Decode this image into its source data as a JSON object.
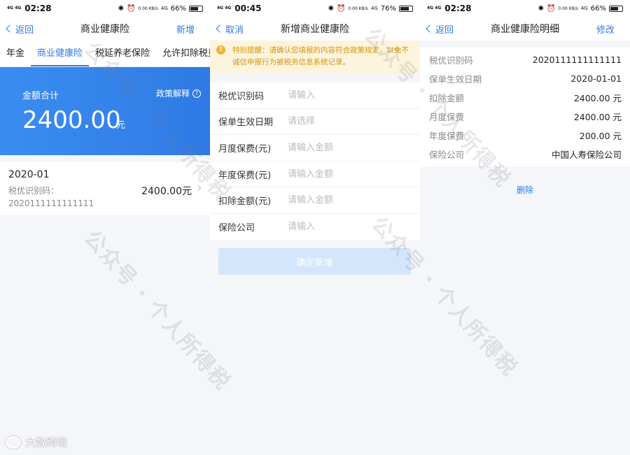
{
  "status_bars": [
    {
      "signal": "4G 4G",
      "time": "02:28",
      "speed": "0.00 KB/s",
      "net": "4G",
      "battery": "66%",
      "battery_level": 0.66
    },
    {
      "signal": "4G 4G",
      "time": "00:45",
      "speed": "0.00 KB/s",
      "net": "4G",
      "battery": "76%",
      "battery_level": 0.76
    },
    {
      "signal": "4G 4G",
      "time": "02:28",
      "speed": "0.00 KB/s",
      "net": "4G",
      "battery": "66%",
      "battery_level": 0.66
    }
  ],
  "screen1": {
    "back_label": "返回",
    "title": "商业健康险",
    "action": "新增",
    "tabs": [
      "年金",
      "商业健康险",
      "税延养老保险",
      "允许扣除税费"
    ],
    "active_tab": 1,
    "summary": {
      "label": "金额合计",
      "policy_link": "政策解释",
      "amount": "2400.00",
      "unit": "元"
    },
    "record": {
      "date": "2020-01",
      "code_label": "税优识别码：",
      "code": "2020111111111111",
      "amount": "2400.00元"
    }
  },
  "screen2": {
    "cancel_label": "取消",
    "title": "新增商业健康险",
    "notice": "特别提醒：请确认您填报的内容符合政策规定，以免不诚信申报行为被税务信息系统记录。",
    "fields": [
      {
        "label": "税优识别码",
        "placeholder": "请输入"
      },
      {
        "label": "保单生效日期",
        "placeholder": "请选择"
      },
      {
        "label": "月度保费(元)",
        "placeholder": "请输入金额"
      },
      {
        "label": "年度保费(元)",
        "placeholder": "请输入金额"
      },
      {
        "label": "扣除金额(元)",
        "placeholder": "请输入金额"
      },
      {
        "label": "保险公司",
        "placeholder": "请输入"
      }
    ],
    "submit_label": "确定新增"
  },
  "screen3": {
    "back_label": "返回",
    "title": "商业健康险明细",
    "action": "修改",
    "rows": [
      {
        "label": "税优识别码",
        "value": "2020111111111111"
      },
      {
        "label": "保单生效日期",
        "value": "2020-01-01"
      },
      {
        "label": "扣除金额",
        "value": "2400.00 元"
      },
      {
        "label": "月度保费",
        "value": "2400.00 元"
      },
      {
        "label": "年度保费",
        "value": "200.00 元"
      },
      {
        "label": "保险公司",
        "value": "中国人寿保险公司"
      }
    ],
    "delete_label": "删除"
  },
  "watermark": "公众号 · 个人所得税",
  "brand": "大数跨境",
  "colors": {
    "accent": "#2f7ae5",
    "notice_bg": "#fdf4dd",
    "notice_text": "#d8950c"
  }
}
